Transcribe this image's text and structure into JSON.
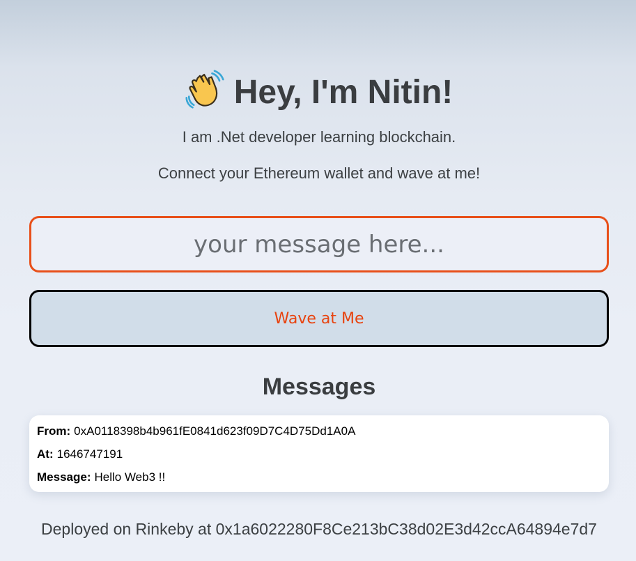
{
  "header": {
    "icon": "waving-hand-icon",
    "title": "Hey, I'm Nitin!"
  },
  "bio": {
    "line1": "I am .Net developer learning blockchain.",
    "line2": "Connect your Ethereum wallet and wave at me!"
  },
  "form": {
    "message_placeholder": "your message here...",
    "message_value": "",
    "wave_button_label": "Wave at Me"
  },
  "messages": {
    "title": "Messages",
    "items": [
      {
        "from_label": "From:",
        "from": "0xA0118398b4b961fE0841d623f09D7C4D75Dd1A0A",
        "at_label": "At:",
        "at": "1646747191",
        "message_label": "Message:",
        "message": "Hello Web3 !!"
      }
    ]
  },
  "footer": {
    "text": "Deployed on Rinkeby at 0x1a6022280F8Ce213bC38d02E3d42ccA64894e7d7"
  },
  "colors": {
    "accent": "#e8501a",
    "button_text": "#e8430f",
    "button_bg": "#d1dde9"
  }
}
